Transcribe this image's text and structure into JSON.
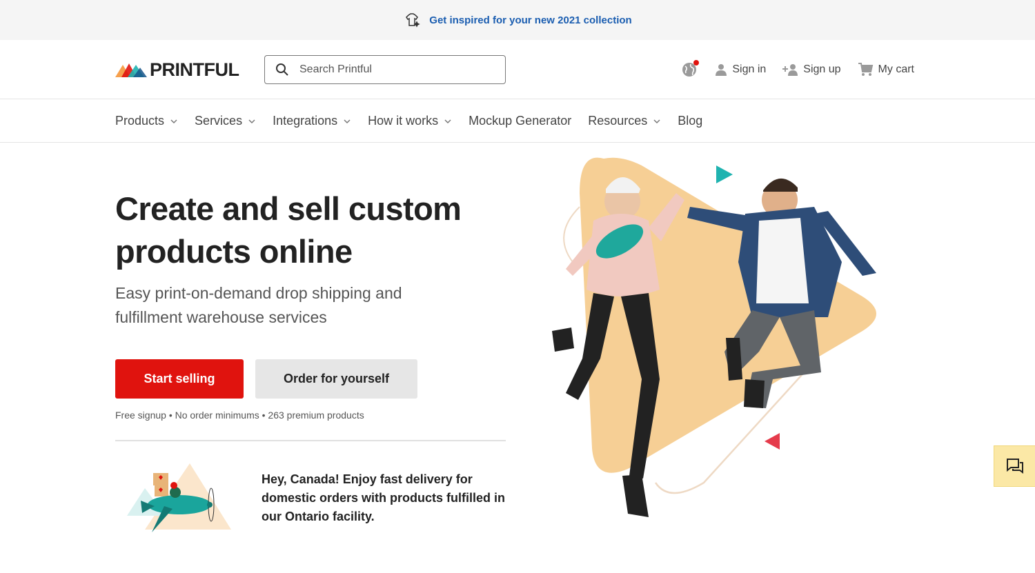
{
  "promo": {
    "text": "Get inspired for your new 2021 collection",
    "icon": "tshirt-sparkle-icon"
  },
  "header": {
    "logo_text": "PRINTFUL",
    "search": {
      "placeholder": "Search Printful",
      "value": ""
    },
    "actions": {
      "sign_in": "Sign in",
      "sign_up": "Sign up",
      "cart": "My cart"
    }
  },
  "nav": {
    "items": [
      {
        "label": "Products",
        "dropdown": true
      },
      {
        "label": "Services",
        "dropdown": true
      },
      {
        "label": "Integrations",
        "dropdown": true
      },
      {
        "label": "How it works",
        "dropdown": true
      },
      {
        "label": "Mockup Generator",
        "dropdown": false
      },
      {
        "label": "Resources",
        "dropdown": true
      },
      {
        "label": "Blog",
        "dropdown": false
      }
    ]
  },
  "hero": {
    "title": "Create and sell custom products online",
    "subtitle": "Easy print-on-demand drop shipping and fulfillment warehouse services",
    "primary_button": "Start selling",
    "secondary_button": "Order for yourself",
    "perks": "Free signup • No order minimums • 263 premium products"
  },
  "canada": {
    "text": "Hey, Canada! Enjoy fast delivery for domestic orders with products fulfilled in our Ontario facility."
  },
  "colors": {
    "accent": "#e0130e",
    "link": "#1a5db0",
    "chat_bg": "#fbe8a6",
    "hero_shape": "#f6cf95"
  }
}
